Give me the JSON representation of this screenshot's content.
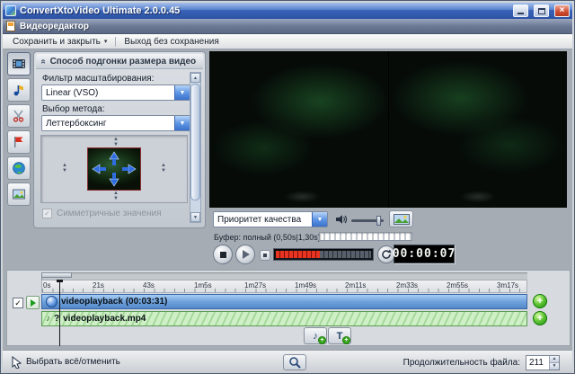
{
  "titlebar": {
    "title": "ConvertXtoVideo Ultimate 2.0.0.45"
  },
  "editor_bar": {
    "title": "Видеоредактор"
  },
  "menubar": {
    "save_close": "Сохранить и закрыть",
    "exit_no_save": "Выход без сохранения"
  },
  "fit_panel": {
    "title": "Способ подгонки размера видео",
    "filter_label": "Фильтр масштабирования:",
    "filter_value": "Linear (VSO)",
    "method_label": "Выбор метода:",
    "method_value": "Леттербоксинг",
    "symmetric_label": "Симметричные значения"
  },
  "preview": {
    "quality_value": "Приоритет качества",
    "buffer_text": "Буфер: полный (0,50s|1,30s)",
    "timer": "00:00:07"
  },
  "timeline": {
    "ruler": [
      "0s",
      "21s",
      "43s",
      "1m5s",
      "1m27s",
      "1m49s",
      "2m11s",
      "2m33s",
      "2m55s",
      "3m17s"
    ],
    "track_video": {
      "label": "videoplayback (00:03:31)"
    },
    "track_audio": {
      "prefix": "?",
      "label": "videoplayback.mp4"
    },
    "insert_text_label": "T"
  },
  "statusbar": {
    "select_toggle": "Выбрать всё/отменить",
    "duration_label": "Продолжительность файла:",
    "duration_value": "211"
  },
  "icons": {
    "close": "×",
    "dropdown_arrow": "▼",
    "menu_arrow": "▾",
    "collapse_chevron": "»",
    "spin_up": "▲",
    "spin_down": "▼",
    "check": "✓",
    "note": "♪",
    "plus": "+"
  },
  "colors": {
    "titlebar_blue": "#3a63b8",
    "combo_button_blue": "#4a80d4",
    "track_blue": "#6ea2dc",
    "track_green": "#bfe8b8",
    "plus_green": "#3aa81e",
    "slider_red": "#d42818",
    "lcd_bg": "#000000"
  }
}
